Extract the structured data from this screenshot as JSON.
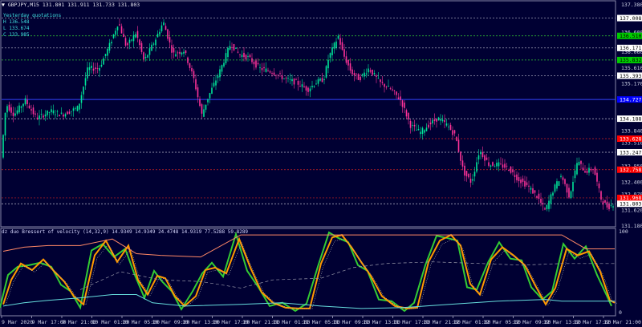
{
  "header": {
    "symbol_line": "GBPJPY,M15  131.801 131.911 131.733 131.803",
    "yesterday_title": "Yesterday quotations",
    "high": "H  136.548",
    "low": "L  133.674",
    "close": "C  133.985"
  },
  "indicator_label": "dz duo Bressert of velocity (14,32,9) 14.9349 14.9349 24.4748 14.9319 77.5288 59.8289",
  "price_axis": {
    "ticks": [
      "137.380",
      "136.600",
      "136.060",
      "135.610",
      "135.170",
      "134.180",
      "133.840",
      "133.510",
      "132.850",
      "132.400",
      "132.070",
      "131.620",
      "131.180"
    ],
    "tags": [
      {
        "text": "137.008",
        "bg": "#ffffff",
        "fg": "#000000"
      },
      {
        "text": "136.510",
        "bg": "#00cc00",
        "fg": "#000000"
      },
      {
        "text": "136.171",
        "bg": "#ffffff",
        "fg": "#000000"
      },
      {
        "text": "135.832",
        "bg": "#00cc00",
        "fg": "#000000"
      },
      {
        "text": "135.393",
        "bg": "#ffffff",
        "fg": "#000000"
      },
      {
        "text": "134.727",
        "bg": "#0000ff",
        "fg": "#ffffff"
      },
      {
        "text": "134.188",
        "bg": "#ffffff",
        "fg": "#000000"
      },
      {
        "text": "133.628",
        "bg": "#ff0000",
        "fg": "#ffffff"
      },
      {
        "text": "133.247",
        "bg": "#ffffff",
        "fg": "#000000"
      },
      {
        "text": "132.758",
        "bg": "#ff0000",
        "fg": "#ffffff"
      },
      {
        "text": "131.968",
        "bg": "#ff0000",
        "fg": "#ffffff"
      },
      {
        "text": "131.803",
        "bg": "#ffffff",
        "fg": "#000000"
      }
    ]
  },
  "indicator_axis": {
    "top": "100",
    "bottom": "0"
  },
  "time_axis": [
    "9 Mar 2020",
    "9 Mar 17:00",
    "9 Mar 21:00",
    "10 Mar 01:00",
    "10 Mar 05:00",
    "10 Mar 09:00",
    "10 Mar 13:00",
    "10 Mar 17:00",
    "10 Mar 21:00",
    "11 Mar 01:00",
    "11 Mar 05:00",
    "11 Mar 09:00",
    "11 Mar 13:00",
    "11 Mar 17:00",
    "11 Mar 21:00",
    "12 Mar 01:00",
    "12 Mar 05:00",
    "12 Mar 09:00",
    "12 Mar 13:00",
    "12 Mar 17:00",
    "12 Mar 21:00"
  ],
  "colors": {
    "bull": "#00e699",
    "bear": "#ff3399",
    "fast": "#ff9900",
    "slow": "#33cc33",
    "aux": "#66dddd",
    "band": "#ff8866"
  }
}
